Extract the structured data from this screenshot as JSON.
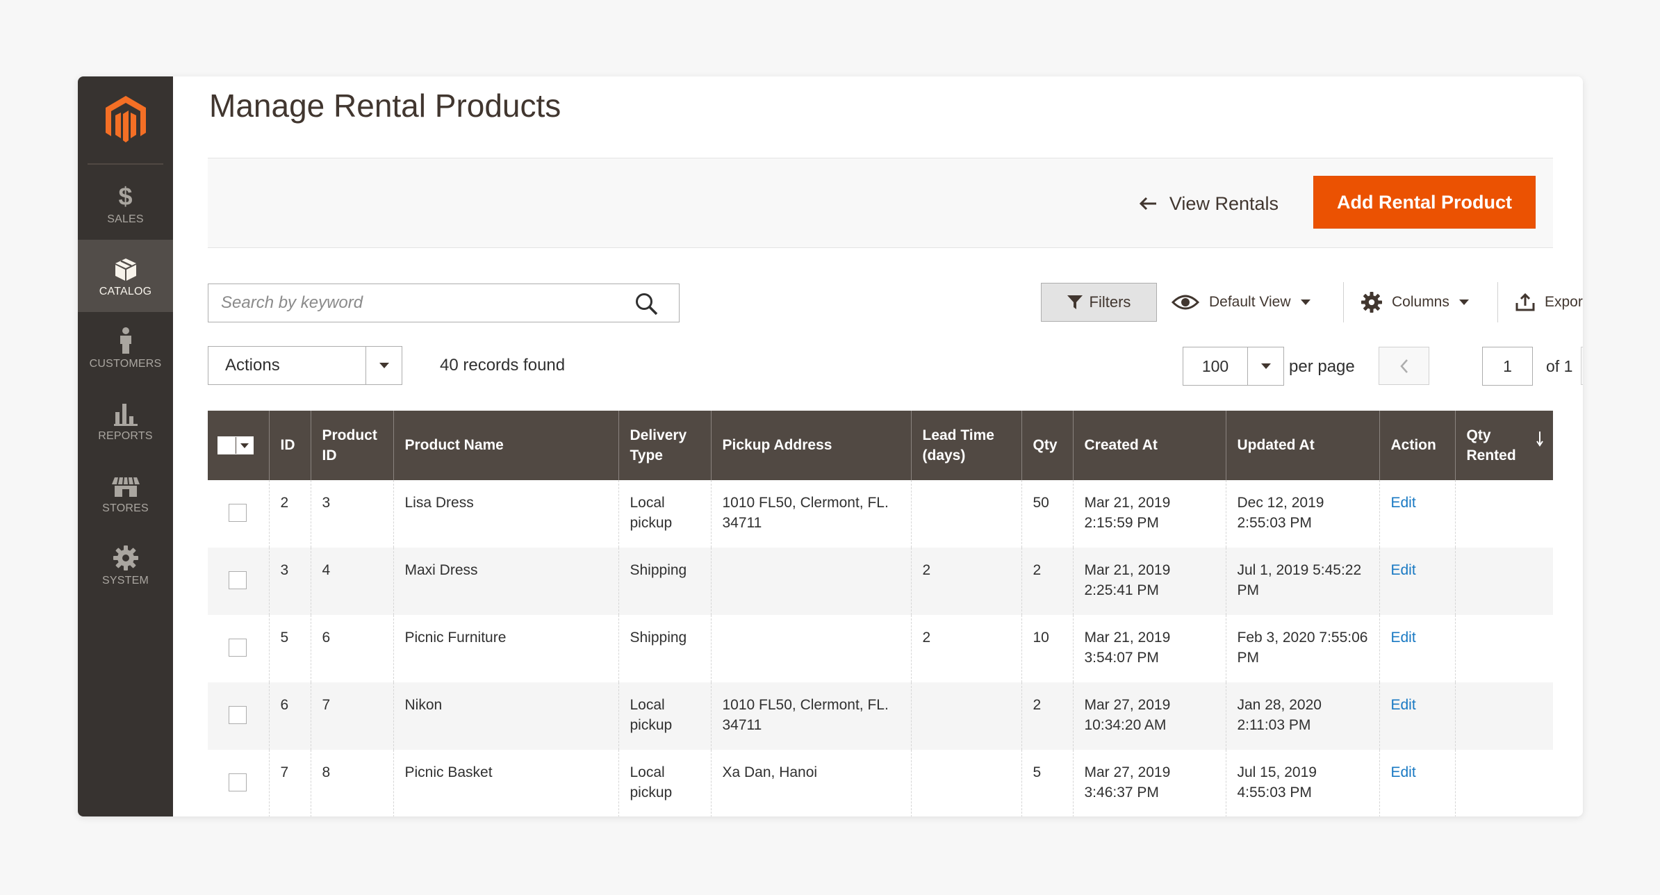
{
  "sidebar": {
    "items": [
      {
        "label": "SALES",
        "icon": "dollar-icon",
        "active": false
      },
      {
        "label": "CATALOG",
        "icon": "cube-icon",
        "active": true
      },
      {
        "label": "CUSTOMERS",
        "icon": "person-icon",
        "active": false
      },
      {
        "label": "REPORTS",
        "icon": "bar-chart-icon",
        "active": false
      },
      {
        "label": "STORES",
        "icon": "storefront-icon",
        "active": false
      },
      {
        "label": "SYSTEM",
        "icon": "gear-icon",
        "active": false
      }
    ]
  },
  "header": {
    "title": "Manage Rental Products",
    "back_label": "View Rentals",
    "primary_label": "Add Rental Product"
  },
  "toolbar": {
    "search_placeholder": "Search by keyword",
    "filters_label": "Filters",
    "view_label": "Default View",
    "columns_label": "Columns",
    "export_label": "Export",
    "actions_label": "Actions",
    "records_found": "40 records found",
    "per_page_value": "100",
    "per_page_label": "per page",
    "current_page": "1",
    "page_of": "of 1"
  },
  "colors": {
    "accent": "#eb5202",
    "sidebar": "#373330",
    "table_header": "#514943",
    "link": "#1979c3"
  },
  "table": {
    "headers": [
      "ID",
      "Product ID",
      "Product Name",
      "Delivery Type",
      "Pickup Address",
      "Lead Time (days)",
      "Qty",
      "Created At",
      "Updated At",
      "Action",
      "Qty Rented"
    ],
    "rows": [
      {
        "id": "2",
        "product_id": "3",
        "name": "Lisa Dress",
        "delivery": "Local pickup",
        "address": "1010 FL50, Clermont, FL. 34711",
        "lead": "",
        "qty": "50",
        "created": "Mar 21, 2019 2:15:59 PM",
        "updated": "Dec 12, 2019 2:55:03 PM",
        "action": "Edit",
        "rented": ""
      },
      {
        "id": "3",
        "product_id": "4",
        "name": "Maxi Dress",
        "delivery": "Shipping",
        "address": "",
        "lead": "2",
        "qty": "2",
        "created": "Mar 21, 2019 2:25:41 PM",
        "updated": "Jul 1, 2019 5:45:22 PM",
        "action": "Edit",
        "rented": ""
      },
      {
        "id": "5",
        "product_id": "6",
        "name": "Picnic Furniture",
        "delivery": "Shipping",
        "address": "",
        "lead": "2",
        "qty": "10",
        "created": "Mar 21, 2019 3:54:07 PM",
        "updated": "Feb 3, 2020 7:55:06 PM",
        "action": "Edit",
        "rented": ""
      },
      {
        "id": "6",
        "product_id": "7",
        "name": "Nikon",
        "delivery": "Local pickup",
        "address": "1010 FL50, Clermont, FL. 34711",
        "lead": "",
        "qty": "2",
        "created": "Mar 27, 2019 10:34:20 AM",
        "updated": "Jan 28, 2020 2:11:03 PM",
        "action": "Edit",
        "rented": ""
      },
      {
        "id": "7",
        "product_id": "8",
        "name": "Picnic Basket",
        "delivery": "Local pickup",
        "address": "Xa Dan, Hanoi",
        "lead": "",
        "qty": "5",
        "created": "Mar 27, 2019 3:46:37 PM",
        "updated": "Jul 15, 2019 4:55:03 PM",
        "action": "Edit",
        "rented": ""
      }
    ]
  }
}
